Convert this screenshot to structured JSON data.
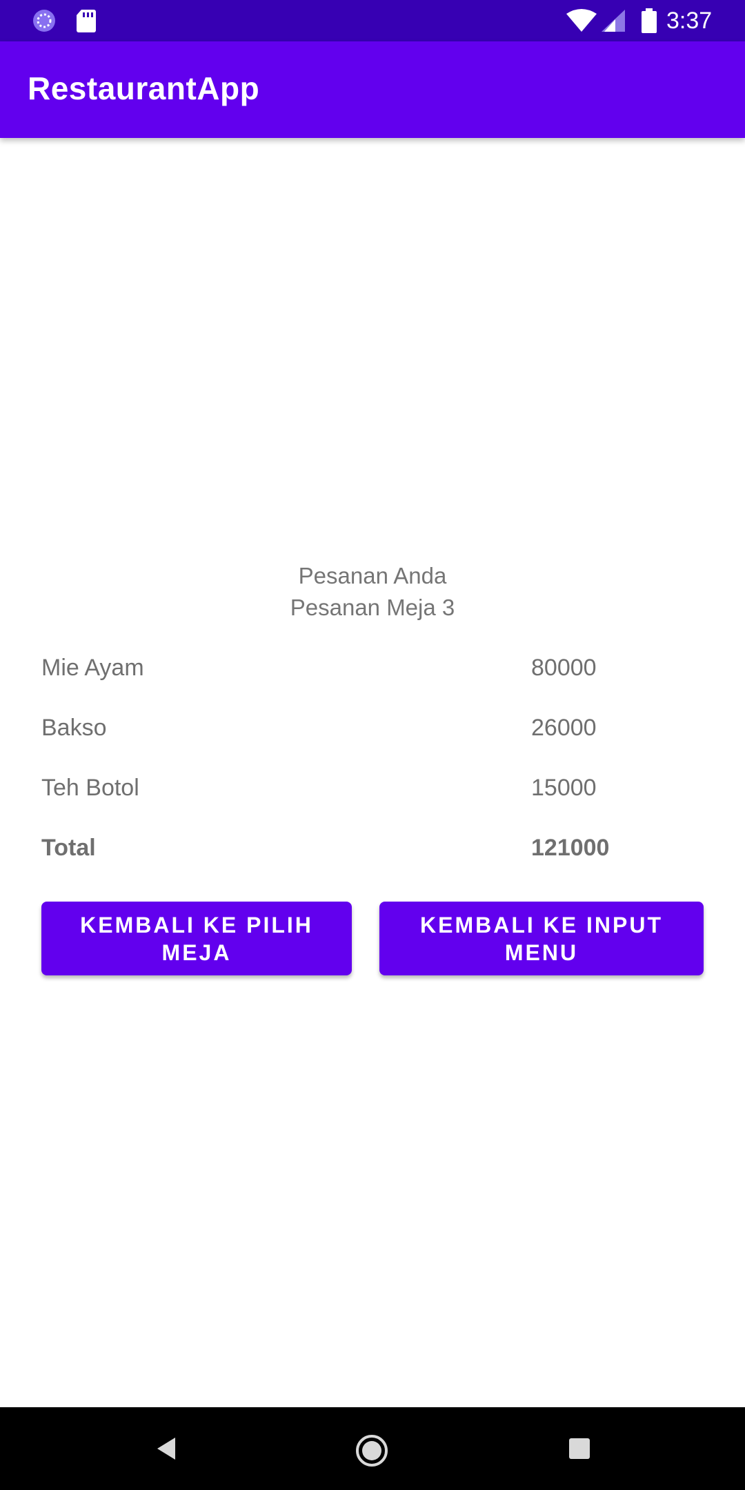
{
  "status_bar": {
    "time": "3:37",
    "icons": [
      "loading-icon",
      "sd-card-icon",
      "wifi-icon",
      "signal-icon",
      "battery-icon"
    ]
  },
  "app_bar": {
    "title": "RestaurantApp"
  },
  "order": {
    "title": "Pesanan Anda",
    "table_label": "Pesanan Meja 3",
    "items": [
      {
        "name": "Mie Ayam",
        "price": "80000"
      },
      {
        "name": "Bakso",
        "price": "26000"
      },
      {
        "name": "Teh Botol",
        "price": "15000"
      }
    ],
    "total_label": "Total",
    "total_value": "121000"
  },
  "buttons": {
    "back_to_table": "KEMBALI KE PILIH MEJA",
    "back_to_menu": "KEMBALI KE INPUT MENU"
  },
  "nav_bar": {
    "icons": [
      "back-icon",
      "home-icon",
      "recent-apps-icon"
    ]
  },
  "colors": {
    "status_bar": "#3700b3",
    "primary": "#6200ee",
    "text_secondary": "#757575"
  }
}
